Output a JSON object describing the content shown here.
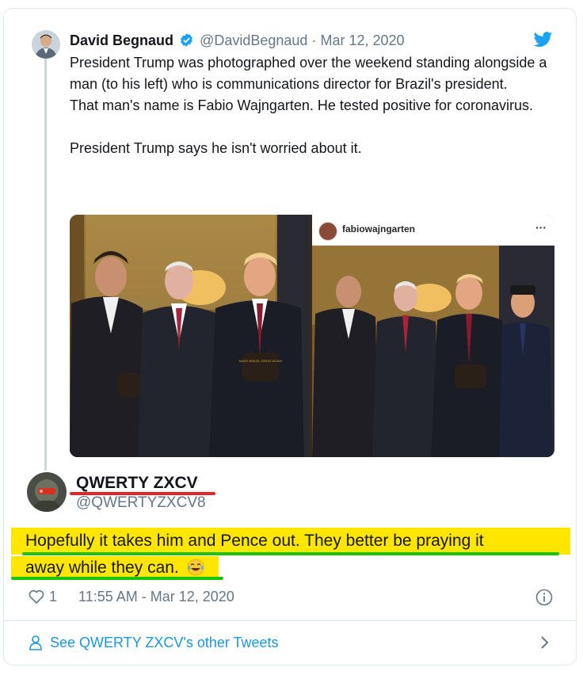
{
  "quoted_tweet": {
    "author_name": "David Begnaud",
    "handle": "@DavidBegnaud",
    "separator": "·",
    "date": "Mar 12, 2020",
    "lines": [
      "President Trump was photographed over the weekend standing alongside a man (to his left) who is communications director for Brazil's president.",
      "That man's name is Fabio Wajngarten. He tested positive for coronavirus.",
      "",
      "President Trump says he isn't worried about it."
    ],
    "instagram_username": "fabiowajngarten",
    "instagram_more": "···",
    "hat_text": "MAKE BRAZIL GREAT AGAIN"
  },
  "reply": {
    "author_name": "QWERTY ZXCV",
    "handle": "@QWERTYZXCV8",
    "text_line1": "Hopefully it takes him and Pence out. They better be praying it",
    "text_line2": "away while they can.",
    "emoji": "face-with-tears-of-joy-icon"
  },
  "meta": {
    "likes": "1",
    "timestamp": "11:55 AM - Mar 12, 2020"
  },
  "footer": {
    "see_more": "See QWERTY ZXCV's other Tweets"
  },
  "colors": {
    "twitter_blue": "#1da1f2",
    "link_blue": "#1b95e0",
    "highlight_yellow": "#ffe600",
    "underline_red": "#e0262a",
    "underline_green": "#19c400",
    "muted_gray": "#657786"
  }
}
